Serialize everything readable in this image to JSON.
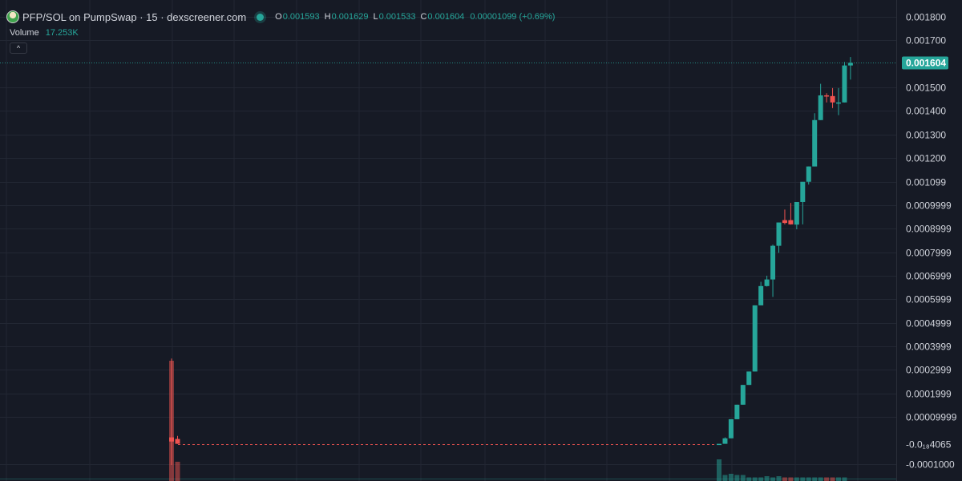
{
  "header": {
    "title": "PFP/SOL on PumpSwap · 15 · dexscreener.com",
    "ohlc": [
      {
        "label": "O",
        "value": "0.001593"
      },
      {
        "label": "H",
        "value": "0.001629"
      },
      {
        "label": "L",
        "value": "0.001533"
      },
      {
        "label": "C",
        "value": "0.001604"
      }
    ],
    "change": "0.00001099 (+0.69%)",
    "collapse_icon": "^"
  },
  "volume": {
    "label": "Volume",
    "value": "17.253K"
  },
  "colors": {
    "up": "#26a69a",
    "down": "#ef5350",
    "background": "#161a25",
    "grid": "#222733",
    "text": "#d1d4dc"
  },
  "chart_data": {
    "type": "candlestick",
    "y_axis_labels": [
      {
        "value": 0.0018,
        "label": "0.001800"
      },
      {
        "value": 0.0017,
        "label": "0.001700"
      },
      {
        "value": 0.0015,
        "label": "0.001500"
      },
      {
        "value": 0.0014,
        "label": "0.001400"
      },
      {
        "value": 0.0013,
        "label": "0.001300"
      },
      {
        "value": 0.0012,
        "label": "0.001200"
      },
      {
        "value": 0.001099,
        "label": "0.001099"
      },
      {
        "value": 0.0009999,
        "label": "0.0009999"
      },
      {
        "value": 0.0008999,
        "label": "0.0008999"
      },
      {
        "value": 0.0007999,
        "label": "0.0007999"
      },
      {
        "value": 0.0006999,
        "label": "0.0006999"
      },
      {
        "value": 0.0005999,
        "label": "0.0005999"
      },
      {
        "value": 0.0004999,
        "label": "0.0004999"
      },
      {
        "value": 0.0003999,
        "label": "0.0003999"
      },
      {
        "value": 0.0002999,
        "label": "0.0002999"
      },
      {
        "value": 0.0001999,
        "label": "0.0001999"
      },
      {
        "value": 9.999e-05,
        "label": "0.00009999"
      },
      {
        "value": -0.0001,
        "label": "-0.0001000"
      }
    ],
    "y_range": [
      -0.000104,
      0.00182
    ],
    "current_price": {
      "value": 0.001604,
      "label": "0.001604"
    },
    "marker_price": {
      "value": -1.41e-05,
      "label": "-0.0₁₈4065"
    },
    "candles_left": [
      {
        "o": 1.32e-05,
        "h": 0.000348,
        "l": -0.000104,
        "c": -4.4e-06
      },
      {
        "o": 6.5e-06,
        "h": 1.95e-05,
        "l": -1.41e-05,
        "c": -1.41e-05
      }
    ],
    "candles_right": [
      {
        "o": -1.41e-05,
        "h": -1.41e-05,
        "l": -1.41e-05,
        "c": -1.41e-05
      },
      {
        "o": -1.41e-05,
        "h": 1.32e-05,
        "l": -1.41e-05,
        "c": 9.3e-06
      },
      {
        "o": 9.3e-06,
        "h": 9.04e-05,
        "l": 9.3e-06,
        "c": 9.04e-05
      },
      {
        "o": 9.04e-05,
        "h": 0.000152,
        "l": 9.04e-05,
        "c": 0.000152
      },
      {
        "o": 0.000152,
        "h": 0.000236,
        "l": 0.000152,
        "c": 0.000236
      },
      {
        "o": 0.000236,
        "h": 0.000293,
        "l": 0.000236,
        "c": 0.000293
      },
      {
        "o": 0.000293,
        "h": 0.000574,
        "l": 0.000293,
        "c": 0.000574
      },
      {
        "o": 0.000574,
        "h": 0.000674,
        "l": 0.000574,
        "c": 0.000656
      },
      {
        "o": 0.000656,
        "h": 0.0007,
        "l": 0.000654,
        "c": 0.000684
      },
      {
        "o": 0.000684,
        "h": 0.000832,
        "l": 0.00061,
        "c": 0.000827
      },
      {
        "o": 0.000827,
        "h": 0.000926,
        "l": 0.000797,
        "c": 0.000926
      },
      {
        "o": 0.000936,
        "h": 0.000981,
        "l": 0.000918,
        "c": 0.000924
      },
      {
        "o": 0.000936,
        "h": 0.001009,
        "l": 0.000917,
        "c": 0.000918
      },
      {
        "o": 0.000917,
        "h": 0.001003,
        "l": 0.000897,
        "c": 0.001013
      },
      {
        "o": 0.001013,
        "h": 0.001013,
        "l": 0.000918,
        "c": 0.001099
      },
      {
        "o": 0.001099,
        "h": 0.001164,
        "l": 0.001087,
        "c": 0.001164
      },
      {
        "o": 0.001164,
        "h": 0.00139,
        "l": 0.001164,
        "c": 0.001361
      },
      {
        "o": 0.001361,
        "h": 0.001515,
        "l": 0.001361,
        "c": 0.001466
      },
      {
        "o": 0.001466,
        "h": 0.001475,
        "l": 0.001436,
        "c": 0.001463
      },
      {
        "o": 0.001463,
        "h": 0.001497,
        "l": 0.001412,
        "c": 0.001436
      },
      {
        "o": 0.001436,
        "h": 0.001497,
        "l": 0.001382,
        "c": 0.001436
      },
      {
        "o": 0.001436,
        "h": 0.001608,
        "l": 0.001436,
        "c": 0.001593
      },
      {
        "o": 0.001593,
        "h": 0.001629,
        "l": 0.001533,
        "c": 0.001604
      }
    ],
    "volume_left": [
      1.0,
      0.16
    ],
    "volume_right": [
      0.18,
      0.05,
      0.06,
      0.05,
      0.05,
      0.03,
      0.03,
      0.03,
      0.04,
      0.03,
      0.04,
      0.03,
      0.03,
      0.03,
      0.03,
      0.03,
      0.03,
      0.03,
      0.03,
      0.03,
      0.03,
      0.03
    ]
  }
}
